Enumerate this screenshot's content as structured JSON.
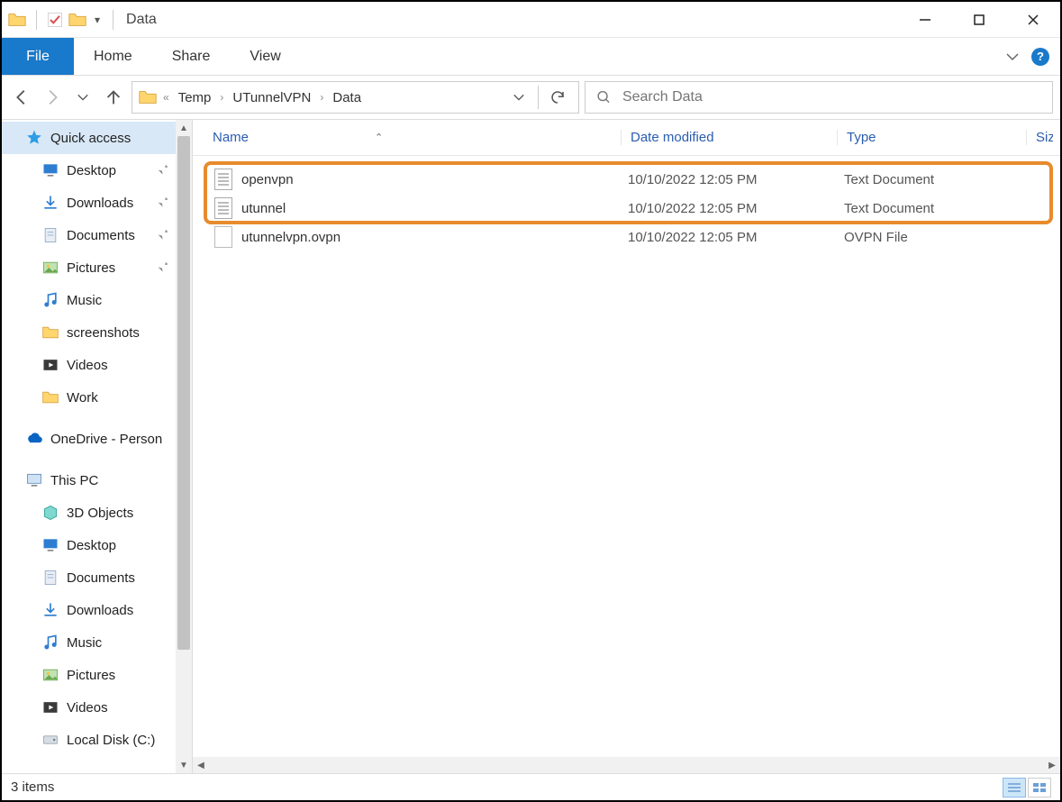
{
  "window": {
    "title": "Data"
  },
  "ribbon": {
    "file": "File",
    "tabs": [
      "Home",
      "Share",
      "View"
    ]
  },
  "breadcrumb": {
    "segments": [
      "Temp",
      "UTunnelVPN",
      "Data"
    ]
  },
  "search": {
    "placeholder": "Search Data"
  },
  "columns": {
    "name": "Name",
    "date": "Date modified",
    "type": "Type",
    "size": "Siz"
  },
  "files": [
    {
      "name": "openvpn",
      "date": "10/10/2022 12:05 PM",
      "type": "Text Document",
      "icon": "doc"
    },
    {
      "name": "utunnel",
      "date": "10/10/2022 12:05 PM",
      "type": "Text Document",
      "icon": "doc"
    },
    {
      "name": "utunnelvpn.ovpn",
      "date": "10/10/2022 12:05 PM",
      "type": "OVPN File",
      "icon": "blank"
    }
  ],
  "sidebar": {
    "quick_access": {
      "label": "Quick access",
      "items": [
        {
          "label": "Desktop",
          "icon": "desktop",
          "pinned": true
        },
        {
          "label": "Downloads",
          "icon": "download",
          "pinned": true
        },
        {
          "label": "Documents",
          "icon": "docs",
          "pinned": true
        },
        {
          "label": "Pictures",
          "icon": "pictures",
          "pinned": true
        },
        {
          "label": "Music",
          "icon": "music",
          "pinned": false
        },
        {
          "label": "screenshots",
          "icon": "folder",
          "pinned": false
        },
        {
          "label": "Videos",
          "icon": "videos",
          "pinned": false
        },
        {
          "label": "Work",
          "icon": "folder",
          "pinned": false
        }
      ]
    },
    "onedrive": {
      "label": "OneDrive - Person"
    },
    "this_pc": {
      "label": "This PC",
      "items": [
        {
          "label": "3D Objects",
          "icon": "3d"
        },
        {
          "label": "Desktop",
          "icon": "desktop"
        },
        {
          "label": "Documents",
          "icon": "docs"
        },
        {
          "label": "Downloads",
          "icon": "download"
        },
        {
          "label": "Music",
          "icon": "music"
        },
        {
          "label": "Pictures",
          "icon": "pictures"
        },
        {
          "label": "Videos",
          "icon": "videos"
        },
        {
          "label": "Local Disk (C:)",
          "icon": "disk"
        }
      ]
    }
  },
  "status": {
    "text": "3 items"
  }
}
